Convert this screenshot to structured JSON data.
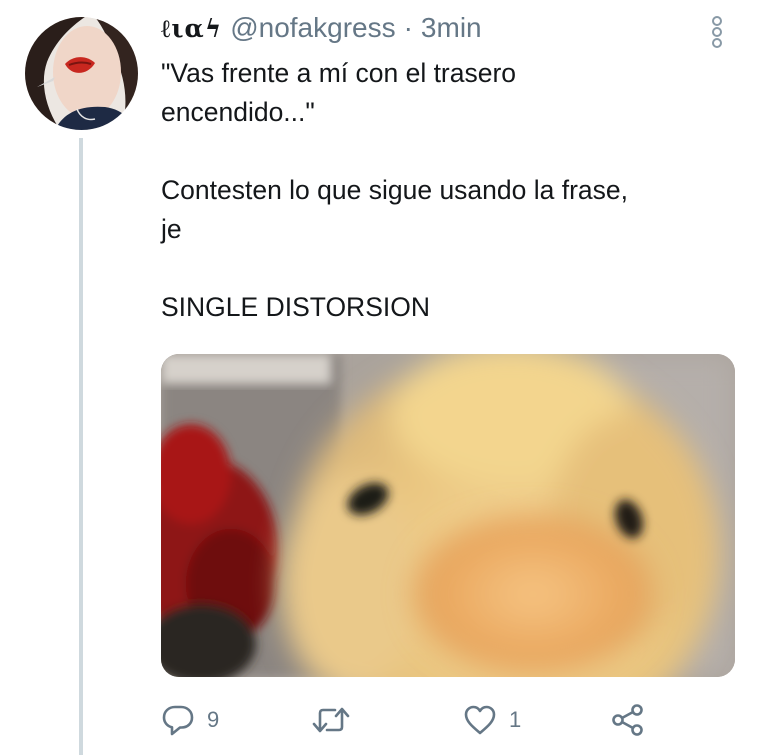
{
  "tweet": {
    "display_name": "ℓιαϟ",
    "handle": "@nofakgress",
    "separator": "·",
    "time": "3min",
    "text": "\"Vas frente a mí con el trasero\nencendido...\"\n\nContesten lo que sigue usando la frase,\nje\n\nSINGLE DISTORSION",
    "media_alt": "blurry close-up of a yellow duckling",
    "actions": {
      "reply_count": "9",
      "retweet_count": "",
      "like_count": "1"
    }
  },
  "colors": {
    "text": "#14171a",
    "muted": "#657786",
    "thread_line": "#cfd9de"
  },
  "icons": [
    "more-vertical-icon",
    "reply-icon",
    "retweet-icon",
    "like-icon",
    "share-icon"
  ]
}
